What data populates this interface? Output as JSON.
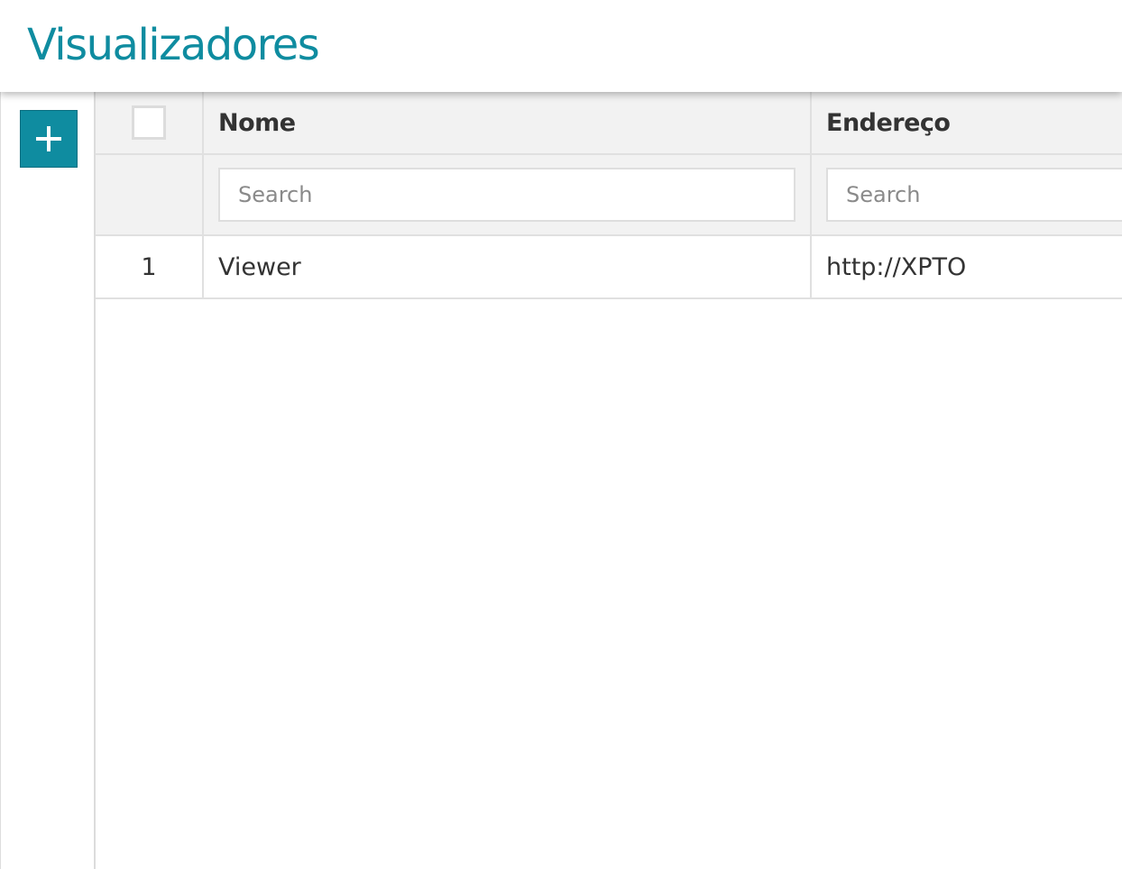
{
  "page": {
    "title": "Visualizadores"
  },
  "colors": {
    "accent": "#0f8ca0",
    "header_bg": "#f2f2f2",
    "border": "#e0e0e0"
  },
  "toolbar": {
    "add_icon": "plus-icon"
  },
  "table": {
    "columns": [
      {
        "label": ""
      },
      {
        "label": "Nome"
      },
      {
        "label": "Endereço"
      }
    ],
    "filters": {
      "name_placeholder": "Search",
      "address_placeholder": "Search"
    },
    "rows": [
      {
        "index": "1",
        "name": "Viewer",
        "address": "http://XPTO"
      }
    ]
  }
}
